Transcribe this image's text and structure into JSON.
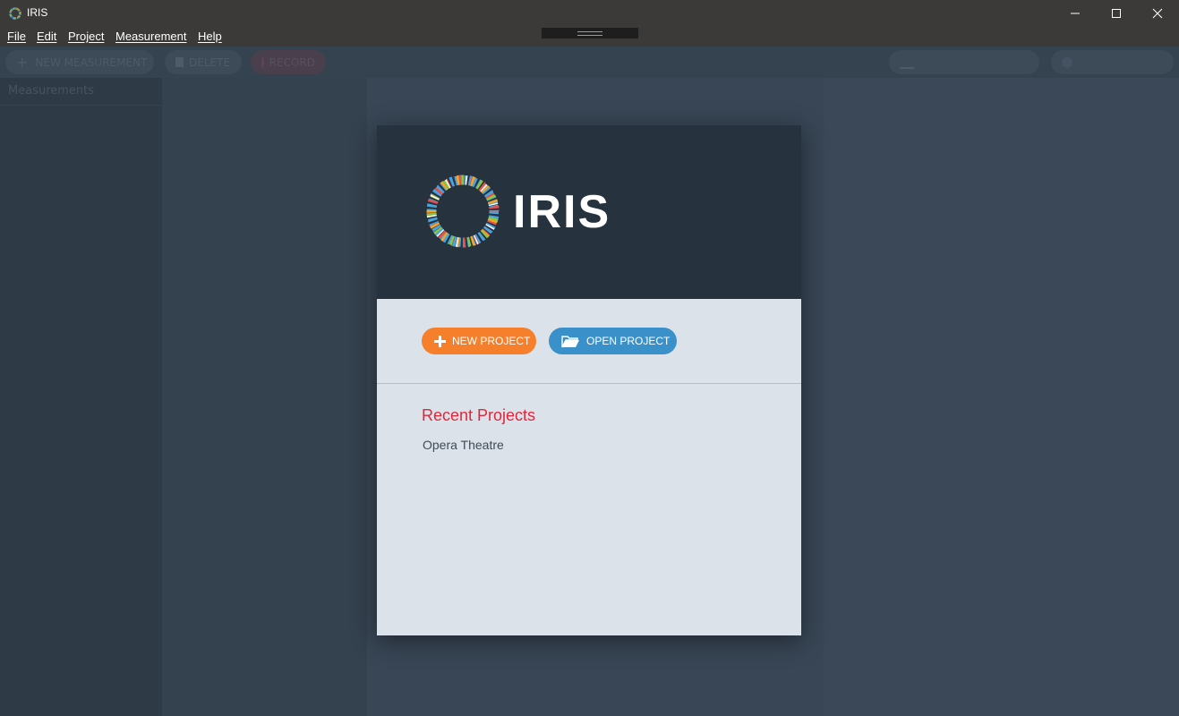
{
  "window": {
    "title": "IRIS"
  },
  "menu": [
    "File",
    "Edit",
    "Project",
    "Measurement",
    "Help"
  ],
  "toolbar": {
    "new_label": "NEW MEASUREMENT",
    "delete_label": "DELETE",
    "record_label": "RECORD",
    "right1_label": "",
    "right2_label": ""
  },
  "sidebar": {
    "header": "Measurements"
  },
  "dialog": {
    "logo_text": "IRIS",
    "new_project_label": "NEW PROJECT",
    "open_project_label": "OPEN PROJECT",
    "recent_title": "Recent Projects",
    "recent_projects": [
      "Opera Theatre"
    ]
  },
  "colors": {
    "accent_orange": "#f57f2a",
    "accent_blue": "#3a90c8",
    "recent_red": "#e0263a",
    "header_dark": "#26333f"
  }
}
